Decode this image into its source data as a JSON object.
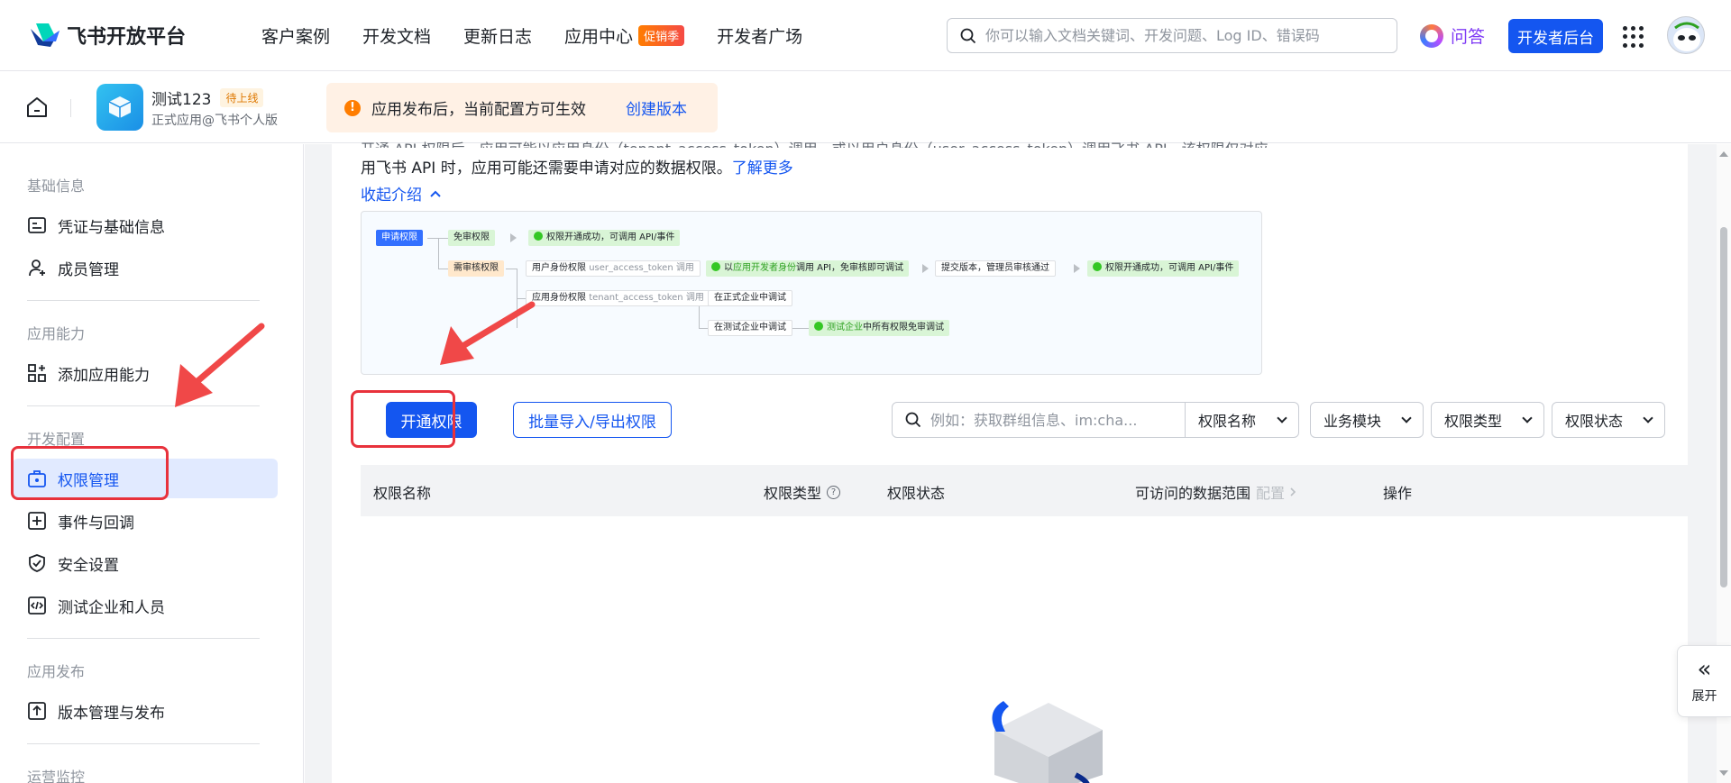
{
  "header": {
    "logo_text": "飞书开放平台",
    "nav": [
      "客户案例",
      "开发文档",
      "更新日志",
      "应用中心",
      "开发者广场"
    ],
    "promo_badge": "促销季",
    "search_placeholder": "你可以输入文档关键词、开发问题、Log ID、错误码",
    "qa_label": "问答",
    "dev_console_label": "开发者后台"
  },
  "app": {
    "name": "测试123",
    "status_badge": "待上线",
    "subtitle": "正式应用@飞书个人版",
    "notice_text": "应用发布后，当前配置方可生效",
    "notice_icon": "!",
    "notice_link": "创建版本"
  },
  "sidebar": {
    "sections": [
      {
        "title": "基础信息",
        "items": [
          {
            "label": "凭证与基础信息",
            "icon": "credential-icon"
          },
          {
            "label": "成员管理",
            "icon": "member-icon"
          }
        ]
      },
      {
        "title": "应用能力",
        "items": [
          {
            "label": "添加应用能力",
            "icon": "add-capability-icon"
          }
        ]
      },
      {
        "title": "开发配置",
        "items": [
          {
            "label": "权限管理",
            "icon": "permission-icon",
            "active": true
          },
          {
            "label": "事件与回调",
            "icon": "event-icon"
          },
          {
            "label": "安全设置",
            "icon": "shield-icon"
          },
          {
            "label": "测试企业和人员",
            "icon": "code-icon"
          }
        ]
      },
      {
        "title": "应用发布",
        "items": [
          {
            "label": "版本管理与发布",
            "icon": "upload-icon"
          }
        ]
      },
      {
        "title": "运营监控",
        "items": []
      }
    ]
  },
  "main": {
    "intro_line_hidden": "开通 API 权限后，应用可能以应用身份（tenant_access_token）调用，或以用户身份（user_access_token）调用飞书 API，该权限仅对应",
    "intro_line": "用飞书 API 时，应用可能还需要申请对应的数据权限。",
    "learn_more": "了解更多",
    "collapse_intro": "收起介绍",
    "flow": {
      "apply": "申请权限",
      "free": "免审权限",
      "free_result": "权限开通成功，可调用 API/事件",
      "need_review": "需审核权限",
      "user_perm": "用户身份权限",
      "user_token": "user_access_token 调用",
      "dev_identity_pre": "以",
      "dev_identity_hl": "应用开发者身份",
      "dev_identity_post": "调用 API，免审核即可调试",
      "submit": "提交版本，管理员审核通过",
      "final_result": "权限开通成功，可调用 API/事件",
      "tenant_perm": "应用身份权限",
      "tenant_token": "tenant_access_token 调用",
      "formal_debug": "在正式企业中调试",
      "test_debug": "在测试企业中调试",
      "test_free_hl": "测试企业",
      "test_free_post": "中所有权限免审调试"
    },
    "open_button": "开通权限",
    "batch_button": "批量导入/导出权限",
    "filter_placeholder": "例如：获取群组信息、im:cha...",
    "filters": [
      "权限名称",
      "业务模块",
      "权限类型",
      "权限状态"
    ],
    "table_headers": [
      "权限名称",
      "权限类型",
      "权限状态",
      "可访问的数据范围",
      "操作"
    ],
    "config_link": "配置",
    "help_icon": "?"
  },
  "expand": {
    "icon": "«",
    "label": "展开"
  },
  "colors": {
    "brand": "#1456f0",
    "active_bg": "#e1eaff",
    "highlight_red": "#e8323c",
    "annotation_arrow": "#f04848"
  }
}
